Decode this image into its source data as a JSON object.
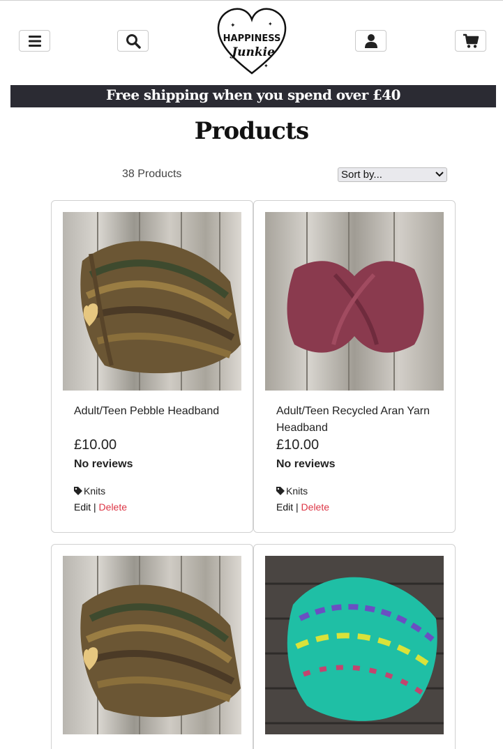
{
  "header": {
    "logo_line1": "HAPPINESS",
    "logo_line2": "Junkie"
  },
  "banner": {
    "text": "Free shipping when you spend over £40"
  },
  "page": {
    "title": "Products",
    "count": "38 Products",
    "sort_selected": "Sort by..."
  },
  "products": [
    {
      "name": "Adult/Teen Pebble Headband",
      "price": "£10.00",
      "reviews": "No reviews",
      "category": "Knits",
      "edit": "Edit",
      "sep": "|",
      "delete": "Delete"
    },
    {
      "name": "Adult/Teen Recycled Aran Yarn Headband",
      "price": "£10.00",
      "reviews": "No reviews",
      "category": "Knits",
      "edit": "Edit",
      "sep": "|",
      "delete": "Delete"
    },
    {
      "name": "",
      "price": "",
      "reviews": "",
      "category": "",
      "edit": "",
      "sep": "",
      "delete": ""
    },
    {
      "name": "",
      "price": "",
      "reviews": "",
      "category": "",
      "edit": "",
      "sep": "",
      "delete": ""
    }
  ],
  "colors": {
    "banner_bg": "#2b2b33",
    "delete_red": "#dc3545"
  }
}
